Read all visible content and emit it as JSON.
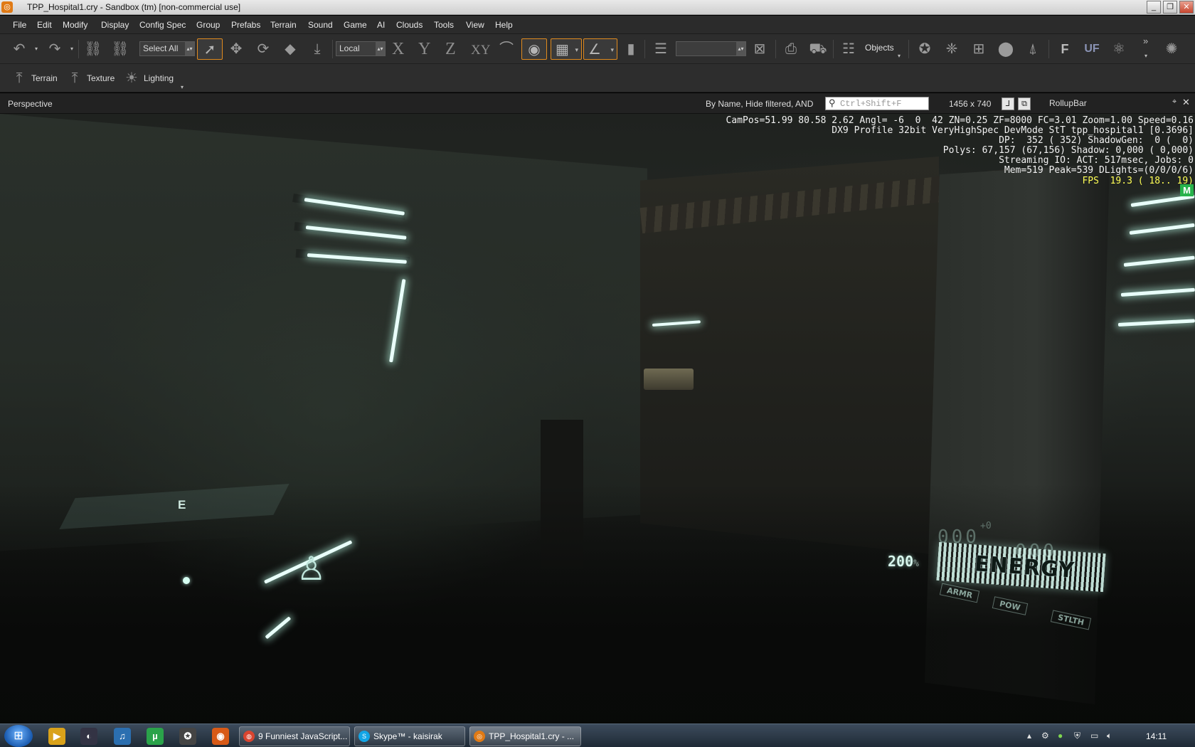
{
  "window": {
    "title": "TPP_Hospital1.cry - Sandbox (tm) [non-commercial use]",
    "controls": [
      "_",
      "❐",
      "✕"
    ]
  },
  "menu": [
    "File",
    "Edit",
    "Modify",
    "Display",
    "Config Spec",
    "Group",
    "Prefabs",
    "Terrain",
    "Sound",
    "Game",
    "AI",
    "Clouds",
    "Tools",
    "View",
    "Help"
  ],
  "toolbar": {
    "selection_value": "Select All",
    "coord_system_value": "Local",
    "axes": [
      "X",
      "Y",
      "Z",
      "XY"
    ],
    "layer_value": "",
    "objects_label": "Objects",
    "more_label": "»"
  },
  "toolbar2": {
    "terrain_label": "Terrain",
    "texture_label": "Texture",
    "lighting_label": "Lighting"
  },
  "viewport": {
    "title": "Perspective",
    "filter_text": "By Name, Hide filtered, AND",
    "search_placeholder": "Ctrl+Shift+F",
    "resolution": "1456 x 740"
  },
  "rollup": {
    "title": "RollupBar"
  },
  "stats": {
    "line1": "CamPos=51.99 80.58 2.62 Angl= -6  0  42 ZN=0.25 ZF=8000 FC=3.01 Zoom=1.00 Speed=0.16",
    "line2": "DX9 Profile 32bit VeryHighSpec DevMode StT tpp_hospital1 [0.3696]",
    "line3": "DP:  352 ( 352) ShadowGen:  0 (  0)",
    "line4": "Polys: 67,157 (67,156) Shadow: 0,000 ( 0,000)",
    "line5": "Streaming IO: ACT: 517msec, Jobs: 0",
    "line6": "Mem=519 Peak=539 DLights=(0/0/0/6)",
    "fps": "FPS  19.3 ( 18.. 19)"
  },
  "hud": {
    "badge": "M",
    "nav_letter": "E",
    "health": "200",
    "health_unit": "%",
    "ammo_left": "000",
    "ammo_right": "000",
    "ammo_plus": "+0",
    "energy_label": "ENERGY",
    "modes": [
      "ARMR",
      "POW",
      "STLTH"
    ]
  },
  "taskbar": {
    "tasks": [
      {
        "label": "9 Funniest JavaScript...",
        "icon_color": "#d9442f"
      },
      {
        "label": "Skype™ - kaisirak",
        "icon_color": "#12a5e6"
      },
      {
        "label": "TPP_Hospital1.cry - ...",
        "icon_color": "#e07a15"
      }
    ],
    "clock": "14:11"
  }
}
